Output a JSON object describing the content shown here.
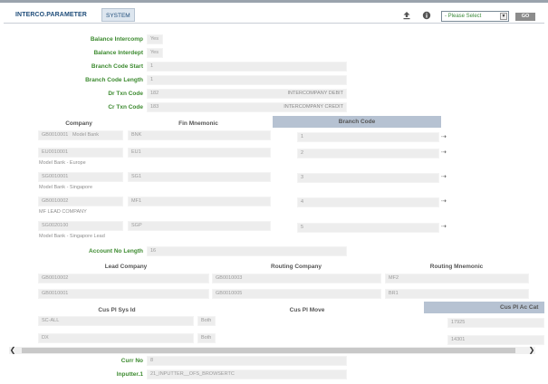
{
  "header": {
    "title": "INTERCO.PARAMETER",
    "system_tag": "SYSTEM",
    "select_placeholder": "- Please Select",
    "go_label": "GO",
    "icons": [
      "upload-icon",
      "info-icon"
    ]
  },
  "fields": {
    "balance_intercomp": {
      "label": "Balance Intercomp",
      "value": "Yes"
    },
    "balance_interdept": {
      "label": "Balance Interdept",
      "value": "Yes"
    },
    "branch_code_start": {
      "label": "Branch Code Start",
      "value": "1"
    },
    "branch_code_length": {
      "label": "Branch Code Length",
      "value": "1"
    },
    "dr_txn_code": {
      "label": "Dr Txn Code",
      "value": "182",
      "description": "INTERCOMPANY DEBIT"
    },
    "cr_txn_code": {
      "label": "Cr Txn Code",
      "value": "183",
      "description": "INTERCOMPANY CREDIT"
    },
    "account_no_length": {
      "label": "Account No Length",
      "value": "16"
    },
    "curr_no": {
      "label": "Curr No",
      "value": "8"
    },
    "inputter": {
      "label": "Inputter.1",
      "value": "21_INPUTTER__OFS_BROWSERTC"
    }
  },
  "company_table": {
    "headers": {
      "company": "Company",
      "fin_mnemonic": "Fin Mnemonic",
      "branch_code": "Branch Code"
    },
    "rows": [
      {
        "company": "GB0010001",
        "company_name": "Model Bank",
        "mnemonic": "BNK",
        "branch": "1",
        "sub_name": ""
      },
      {
        "company": "EU0010001",
        "company_name": "",
        "mnemonic": "EU1",
        "branch": "2",
        "sub_name": "Model Bank - Europe"
      },
      {
        "company": "SG0010001",
        "company_name": "",
        "mnemonic": "SG1",
        "branch": "3",
        "sub_name": "Model Bank - Singapore"
      },
      {
        "company": "GB0010002",
        "company_name": "",
        "mnemonic": "MF1",
        "branch": "4",
        "sub_name": "MF LEAD COMPANY"
      },
      {
        "company": "SG0020100",
        "company_name": "",
        "mnemonic": "SGP",
        "branch": "5",
        "sub_name": "Model Bank - Singapore Lead"
      }
    ]
  },
  "routing_table": {
    "headers": {
      "lead_company": "Lead Company",
      "routing_company": "Routing Company",
      "routing_mnemonic": "Routing Mnemonic"
    },
    "rows": [
      {
        "lead": "GB0010002",
        "routing": "GB0010003",
        "mnemonic": "MF2"
      },
      {
        "lead": "GB0010001",
        "routing": "GB0010005",
        "mnemonic": "BR1"
      }
    ]
  },
  "cus_table": {
    "headers": {
      "sys_id": "Cus Pl Sys Id",
      "move": "Cus Pl Move",
      "ac_cat": "Cus Pl Ac Cat"
    },
    "rows": [
      {
        "sys_id": "SC-ALL",
        "move": "Both",
        "ac_cat": "17925"
      },
      {
        "sys_id": "DX",
        "move": "Both",
        "ac_cat": "14301"
      }
    ]
  },
  "scrollbar": {
    "left_arrow": "❮",
    "right_arrow": "❯"
  },
  "link_glyph": "⇢"
}
